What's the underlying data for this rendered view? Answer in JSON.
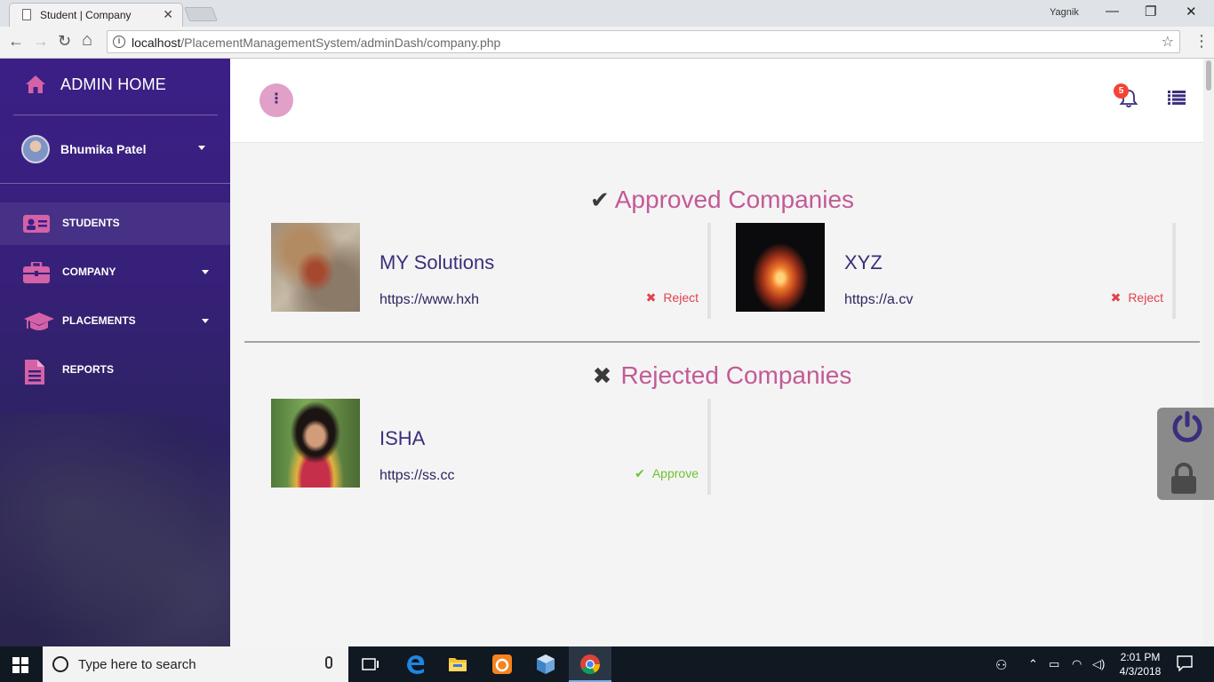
{
  "browser": {
    "tab_title": "Student | Company",
    "tab_close": "✕",
    "window_user": "Yagnik",
    "window_controls": {
      "minimize": "—",
      "restore": "❐",
      "close": "✕"
    },
    "url_host": "localhost",
    "url_path": "/PlacementManagementSystem/adminDash/company.php",
    "nav": {
      "back": "←",
      "forward": "→",
      "reload": "↻",
      "home": "⌂"
    },
    "star": "☆",
    "menu": "⋮"
  },
  "sidebar": {
    "brand": "ADMIN HOME",
    "user_name": "Bhumika Patel",
    "items": [
      {
        "label": "STUDENTS",
        "icon": "id-card-icon",
        "has_caret": false,
        "active": true
      },
      {
        "label": "COMPANY",
        "icon": "briefcase-icon",
        "has_caret": true,
        "active": false
      },
      {
        "label": "PLACEMENTS",
        "icon": "graduation-cap-icon",
        "has_caret": true,
        "active": false
      },
      {
        "label": "REPORTS",
        "icon": "document-icon",
        "has_caret": false,
        "active": false
      }
    ],
    "accent_color": "#d462a6"
  },
  "topbar": {
    "more_button": "⋮",
    "notification_count": "5"
  },
  "approved": {
    "title": "Approved Companies",
    "icon": "checkmark-icon",
    "companies": [
      {
        "name": "MY Solutions",
        "url": "https://www.hxh",
        "action": "Reject",
        "action_icon": "✖"
      },
      {
        "name": "XYZ",
        "url": "https://a.cv",
        "action": "Reject",
        "action_icon": "✖"
      }
    ]
  },
  "rejected": {
    "title": "Rejected Companies",
    "icon": "cross-icon",
    "companies": [
      {
        "name": "ISHA",
        "url": "https://ss.cc",
        "action": "Approve",
        "action_icon": "✔"
      }
    ]
  },
  "taskbar": {
    "search_placeholder": "Type here to search",
    "time": "2:01 PM",
    "date": "4/3/2018"
  }
}
